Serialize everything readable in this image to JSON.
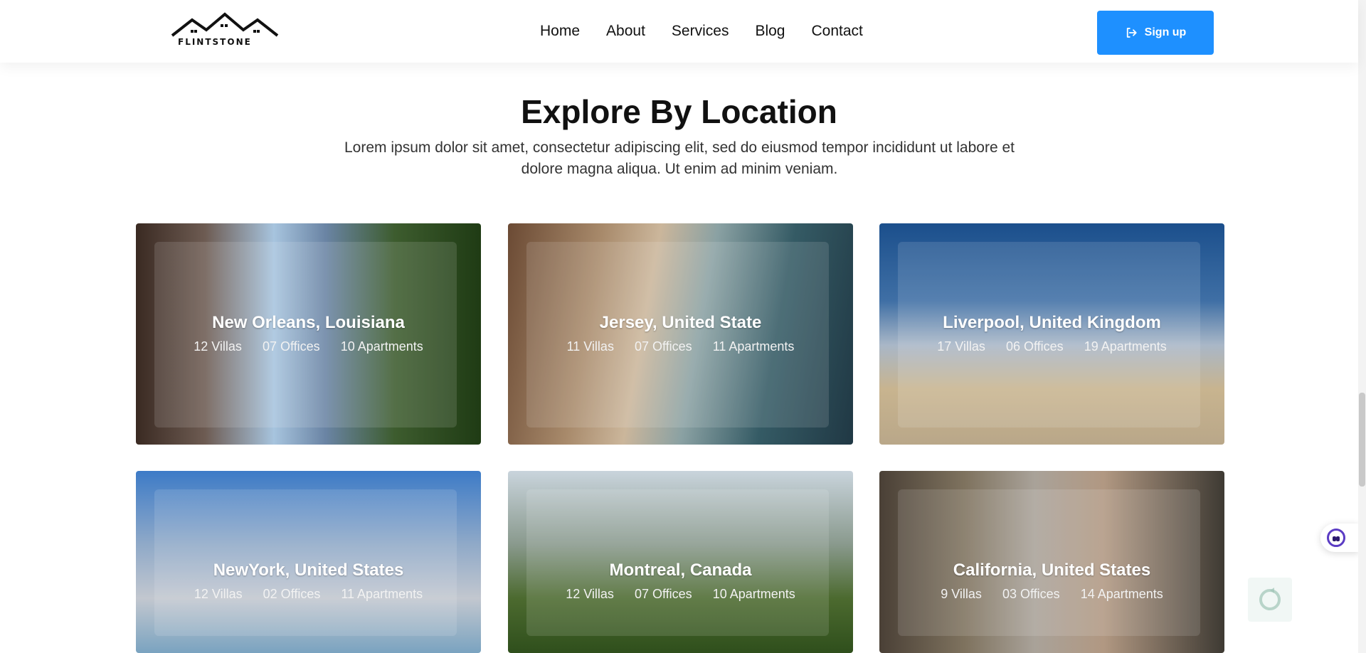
{
  "brand": {
    "name": "FLINTSTONE"
  },
  "nav": {
    "items": [
      "Home",
      "About",
      "Services",
      "Blog",
      "Contact"
    ],
    "signup_label": "Sign up"
  },
  "section": {
    "title": "Explore By Location",
    "subtitle": "Lorem ipsum dolor sit amet, consectetur adipiscing elit, sed do eiusmod tempor incididunt ut labore et dolore magna aliqua. Ut enim ad minim veniam."
  },
  "locations": [
    {
      "name": "New Orleans, Louisiana",
      "villas": "12 Villas",
      "offices": "07 Offices",
      "apartments": "10 Apartments"
    },
    {
      "name": "Jersey, United State",
      "villas": "11 Villas",
      "offices": "07 Offices",
      "apartments": "11 Apartments"
    },
    {
      "name": "Liverpool, United Kingdom",
      "villas": "17 Villas",
      "offices": "06 Offices",
      "apartments": "19 Apartments"
    },
    {
      "name": "NewYork, United States",
      "villas": "12 Villas",
      "offices": "02 Offices",
      "apartments": "11 Apartments"
    },
    {
      "name": "Montreal, Canada",
      "villas": "12 Villas",
      "offices": "07 Offices",
      "apartments": "10 Apartments"
    },
    {
      "name": "California, United States",
      "villas": "9 Villas",
      "offices": "03 Offices",
      "apartments": "14 Apartments"
    }
  ],
  "colors": {
    "accent": "#1e90ff",
    "text": "#111111"
  },
  "icons": {
    "signup": "sign-in-icon",
    "chat": "chat-bot-icon",
    "recaptcha": "recaptcha-icon"
  }
}
